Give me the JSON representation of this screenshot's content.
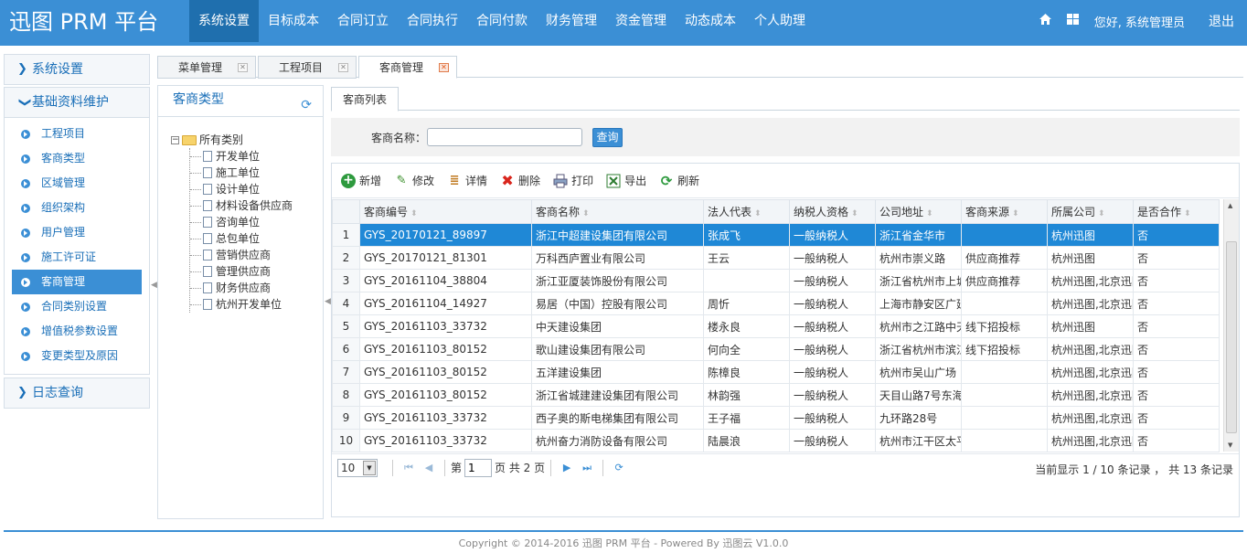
{
  "app": {
    "title": "迅图 PRM 平台"
  },
  "topnav": [
    {
      "label": "系统设置",
      "active": true
    },
    {
      "label": "目标成本"
    },
    {
      "label": "合同订立"
    },
    {
      "label": "合同执行"
    },
    {
      "label": "合同付款"
    },
    {
      "label": "财务管理"
    },
    {
      "label": "资金管理"
    },
    {
      "label": "动态成本"
    },
    {
      "label": "个人助理"
    }
  ],
  "header": {
    "greeting": "您好, 系统管理员",
    "logout": "退出",
    "home_icon": "home-icon",
    "grid_icon": "grid-icon"
  },
  "leftmenu": {
    "system": "系统设置",
    "basic": "基础资料维护",
    "items": [
      "工程项目",
      "客商类型",
      "区域管理",
      "组织架构",
      "用户管理",
      "施工许可证",
      "客商管理",
      "合同类别设置",
      "增值税参数设置",
      "变更类型及原因"
    ],
    "active_index": 6,
    "log": "日志查询"
  },
  "tabs": [
    "菜单管理",
    "工程项目",
    "客商管理"
  ],
  "tree": {
    "title": "客商类型",
    "root": "所有类别",
    "children": [
      "开发单位",
      "施工单位",
      "设计单位",
      "材料设备供应商",
      "咨询单位",
      "总包单位",
      "营销供应商",
      "管理供应商",
      "财务供应商",
      "杭州开发单位"
    ]
  },
  "content": {
    "subtab": "客商列表",
    "search_label": "客商名称：",
    "search_value": "",
    "query_button": "查询",
    "toolbar": {
      "add": "新增",
      "edit": "修改",
      "detail": "详情",
      "delete": "删除",
      "print": "打印",
      "export": "导出",
      "refresh": "刷新"
    }
  },
  "grid": {
    "columns": [
      "客商编号",
      "客商名称",
      "法人代表",
      "纳税人资格",
      "公司地址",
      "客商来源",
      "所属公司",
      "是否合作"
    ],
    "rows": [
      [
        "GYS_20170121_89897",
        "浙江中超建设集团有限公司",
        "张成飞",
        "一般纳税人",
        "浙江省金华市",
        "",
        "杭州迅图",
        "否"
      ],
      [
        "GYS_20170121_81301",
        "万科西庐置业有限公司",
        "王云",
        "一般纳税人",
        "杭州市崇义路",
        "供应商推荐",
        "杭州迅图",
        "否"
      ],
      [
        "GYS_20161104_38804",
        "浙江亚厦装饰股份有限公司",
        "",
        "一般纳税人",
        "浙江省杭州市上城",
        "供应商推荐",
        "杭州迅图,北京迅图",
        "否"
      ],
      [
        "GYS_20161104_14927",
        "易居（中国）控股有限公司",
        "周忻",
        "一般纳税人",
        "上海市静安区广延",
        "",
        "杭州迅图,北京迅图",
        "否"
      ],
      [
        "GYS_20161103_33732",
        "中天建设集团",
        "楼永良",
        "一般纳税人",
        "杭州市之江路中天",
        "线下招投标",
        "杭州迅图",
        "否"
      ],
      [
        "GYS_20161103_80152",
        "歌山建设集团有限公司",
        "何向全",
        "一般纳税人",
        "浙江省杭州市滨江",
        "线下招投标",
        "杭州迅图,北京迅图",
        "否"
      ],
      [
        "GYS_20161103_80152",
        "五洋建设集团",
        "陈樟良",
        "一般纳税人",
        "杭州市吴山广场",
        "",
        "杭州迅图,北京迅图",
        "否"
      ],
      [
        "GYS_20161103_80152",
        "浙江省城建建设集团有限公司",
        "林韵强",
        "一般纳税人",
        "天目山路7号东海",
        "",
        "杭州迅图,北京迅图",
        "否"
      ],
      [
        "GYS_20161103_33732",
        "西子奥的斯电梯集团有限公司",
        "王子福",
        "一般纳税人",
        "九环路28号",
        "",
        "杭州迅图,北京迅图",
        "否"
      ],
      [
        "GYS_20161103_33732",
        "杭州奋力消防设备有限公司",
        "陆晨浪",
        "一般纳税人",
        "杭州市江干区太平",
        "",
        "杭州迅图,北京迅图",
        "否"
      ]
    ],
    "selected_row": 0
  },
  "pager": {
    "page_size": "10",
    "page_prefix": "第",
    "page_value": "1",
    "page_suffix": "页 共 2 页",
    "info": "当前显示 1 / 10 条记录 ， 共 13 条记录"
  },
  "footer": "Copyright © 2014-2016 迅图 PRM 平台 - Powered By 迅图云 V1.0.0"
}
